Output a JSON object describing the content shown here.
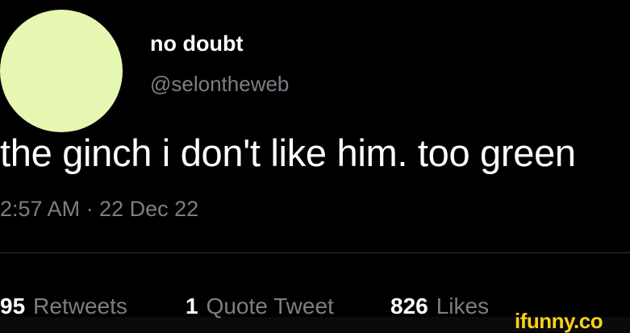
{
  "tweet": {
    "display_name": "no doubt",
    "handle": "@selontheweb",
    "text": "the ginch i don't like him. too green",
    "timestamp": "2:57 AM · 22 Dec 22",
    "avatar_color": "#e6f7b1"
  },
  "stats": {
    "retweets": {
      "count": "95",
      "label": "Retweets"
    },
    "quote_tweets": {
      "count": "1",
      "label": "Quote Tweet"
    },
    "likes": {
      "count": "826",
      "label": "Likes"
    }
  },
  "watermark": {
    "text": "ifunny.co",
    "color": "#f7d21a"
  }
}
